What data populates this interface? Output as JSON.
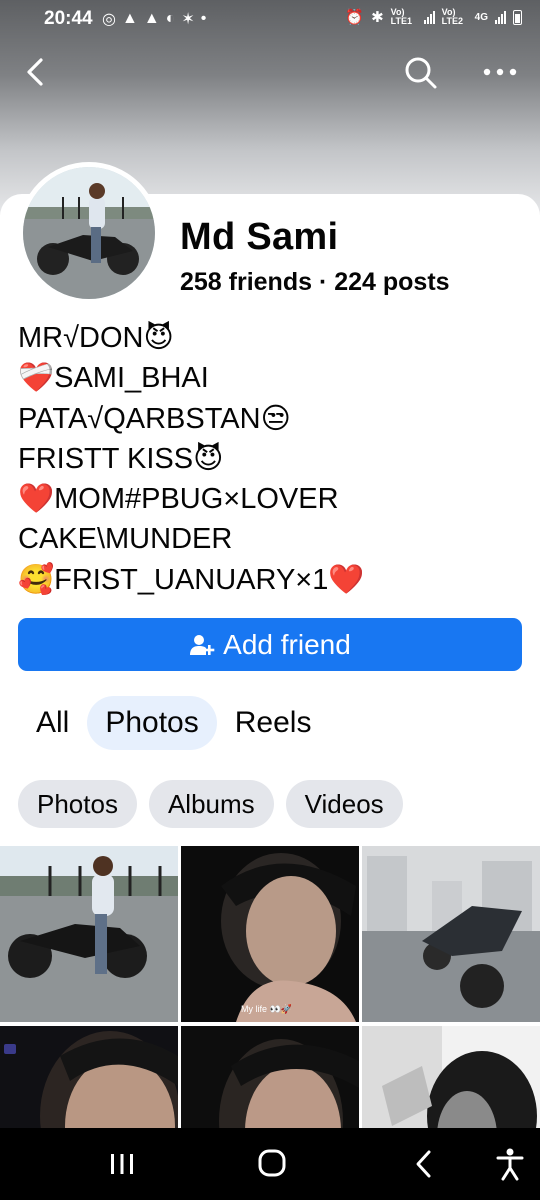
{
  "status_bar": {
    "time": "20:44",
    "net_1": "Vo) LTE1",
    "net_2": "Vo) LTE2",
    "net_4g": "4G"
  },
  "profile": {
    "name": "Md Sami",
    "stats": "258 friends · 224 posts",
    "bio_lines": [
      "MR√DON😈",
      "❤️‍🩹SAMI_BHAI",
      "PATA√QARBSTAN😒",
      "FRISTT KISS😈",
      "❤️MOM#PBUG×LOVER",
      "CAKE\\MUNDER",
      "🥰FRIST_UANUARY×1❤️"
    ]
  },
  "actions": {
    "add_friend_label": "Add friend"
  },
  "tabs": [
    {
      "label": "All",
      "active": false
    },
    {
      "label": "Photos",
      "active": true
    },
    {
      "label": "Reels",
      "active": false
    }
  ],
  "chips": [
    "Photos",
    "Albums",
    "Videos"
  ],
  "photos": {
    "caption_2": "My life 👀🚀"
  },
  "icons": {
    "back": "back-arrow-icon",
    "search": "search-icon",
    "more": "more-dots-icon",
    "add_friend": "person-add-icon"
  },
  "colors": {
    "accent": "#1877f2",
    "active_tab_bg": "#e7f0fd",
    "chip_bg": "#e4e6eb"
  }
}
